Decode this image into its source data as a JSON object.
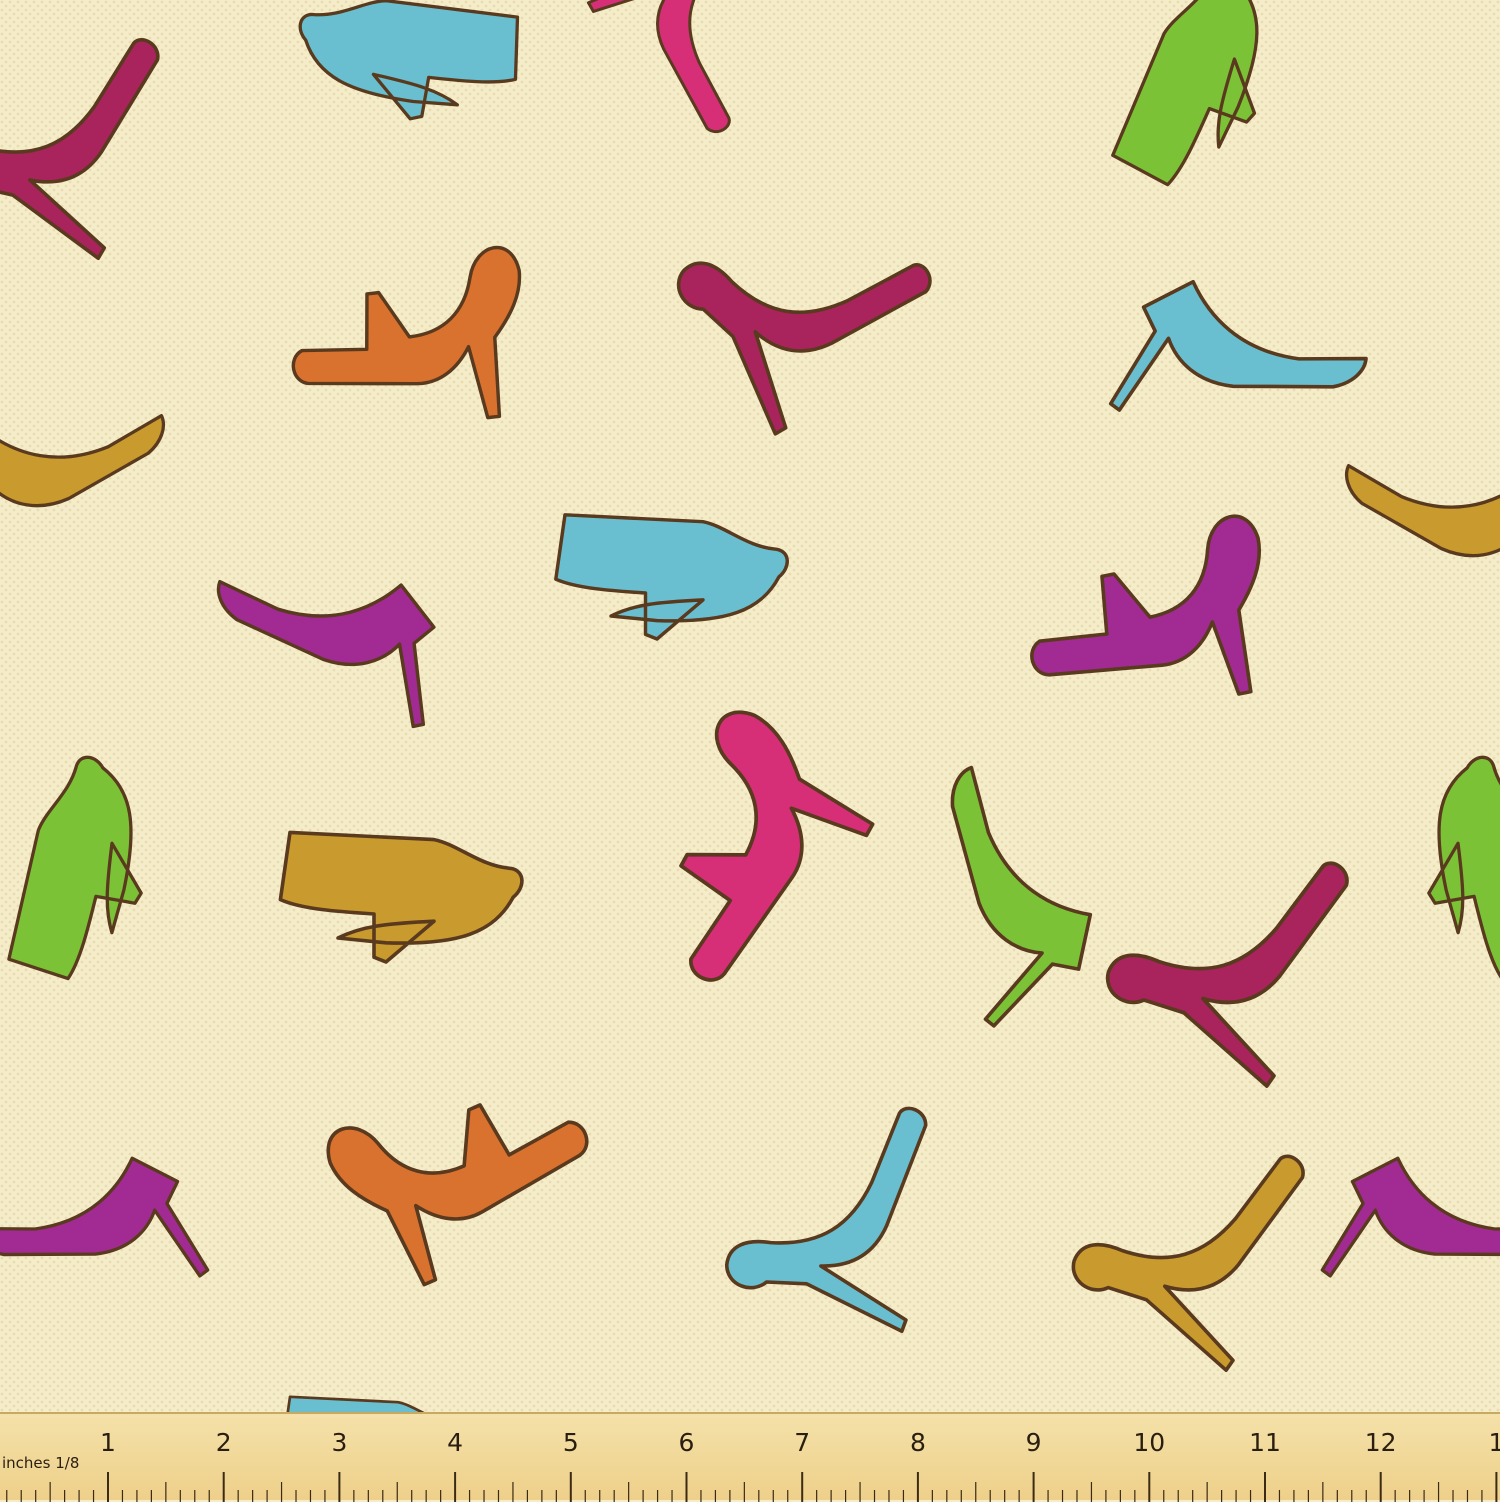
{
  "colors": {
    "background": "#f5ecc9",
    "outline": "#5a3a1e",
    "weave": "#e3d6a8",
    "palette": [
      "#a9245c",
      "#69bfcf",
      "#7cc237",
      "#d9722f",
      "#c99a2e",
      "#a12b92",
      "#d62f78"
    ]
  },
  "image": {
    "subject": "shoe-pattern-fabric",
    "motif": "high-heel-icon"
  },
  "ruler": {
    "unit_label": "inches 1/8",
    "numbers": [
      "1",
      "2",
      "3",
      "4",
      "5",
      "6",
      "7",
      "8",
      "9",
      "10",
      "11",
      "12",
      "1"
    ]
  }
}
